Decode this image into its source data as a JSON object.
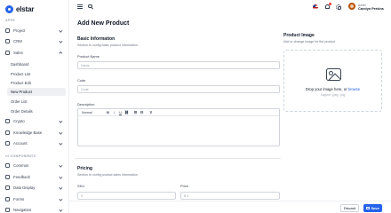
{
  "app": {
    "brand": "elstar"
  },
  "sidebar": {
    "apps_title": "APPS",
    "components_title": "UI COMPONENTS",
    "items": [
      {
        "label": "Project"
      },
      {
        "label": "CRM"
      },
      {
        "label": "Sales"
      },
      {
        "label": "Crypto"
      },
      {
        "label": "Knowledge Base"
      },
      {
        "label": "Account"
      },
      {
        "label": "Common"
      },
      {
        "label": "Feedback"
      },
      {
        "label": "Data Display"
      },
      {
        "label": "Forms"
      },
      {
        "label": "Navigation"
      }
    ],
    "sales_sub": [
      {
        "label": "Dashboard"
      },
      {
        "label": "Product List"
      },
      {
        "label": "Product Edit"
      },
      {
        "label": "New Product",
        "active": true
      },
      {
        "label": "Order List"
      },
      {
        "label": "Order Details"
      }
    ]
  },
  "header": {
    "user_role": "Admin",
    "user_name": "Carolyn Perkins"
  },
  "main": {
    "title": "Add New Product",
    "basic": {
      "title": "Basic Information",
      "subtitle": "Section to config basic product information",
      "name_label": "Product Name",
      "name_placeholder": "Name",
      "code_label": "Code",
      "code_placeholder": "Code",
      "desc_label": "Description"
    },
    "editor": {
      "format": "Normal",
      "bold": "B",
      "italic": "I",
      "underline": "U",
      "link": "⛓",
      "ordered_list": "☰",
      "bullet_list": "☷",
      "clear": "T̸"
    },
    "pricing": {
      "title": "Pricing",
      "subtitle": "Section to config product sales information",
      "sku_label": "SKU",
      "sku_value": "0",
      "price_label": "Price",
      "price_value": "$ 0"
    },
    "image": {
      "title": "Product Image",
      "subtitle": "Add or change image for the product",
      "drop_text": "Drop your image here, or ",
      "browse": "browse",
      "support": "Support: .jpeg, .png"
    }
  },
  "footer": {
    "discard": "Discard",
    "save": "Save"
  }
}
